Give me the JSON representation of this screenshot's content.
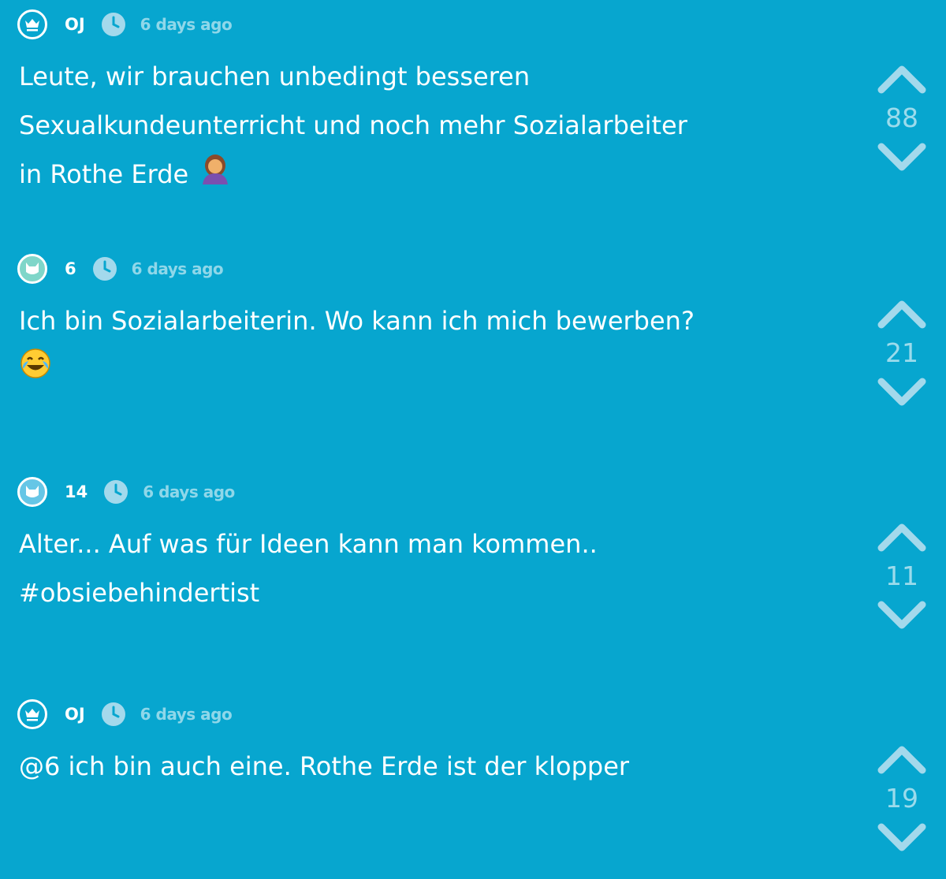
{
  "posts": [
    {
      "author": "OJ",
      "avatar_icon": "crown-icon",
      "time": "6 days ago",
      "lines": [
        "Leute, wir brauchen unbedingt besseren",
        "Sexualkundeunterricht und noch mehr Sozialarbeiter",
        "in Rothe Erde"
      ],
      "emoji": "facepalm-woman-emoji",
      "votes": "88"
    },
    {
      "author": "6",
      "avatar_icon": "cat-icon",
      "avatar_color": "#7fd6c9",
      "time": "6 days ago",
      "lines": [
        "Ich bin Sozialarbeiterin. Wo kann ich mich bewerben?"
      ],
      "emoji": "tears-of-joy-emoji",
      "votes": "21"
    },
    {
      "author": "14",
      "avatar_icon": "cat-icon",
      "avatar_color": "#66c6e6",
      "time": "6 days ago",
      "lines": [
        "Alter... Auf was für Ideen kann man kommen..",
        "#obsiebehindertist"
      ],
      "votes": "11"
    },
    {
      "author": "OJ",
      "avatar_icon": "crown-icon",
      "time": "6 days ago",
      "lines": [
        "@6 ich bin auch eine. Rothe Erde ist der klopper"
      ],
      "votes": "19"
    }
  ],
  "colors": {
    "background": "#07a6cf",
    "text": "#ffffff",
    "muted": "#a3d9ec"
  }
}
